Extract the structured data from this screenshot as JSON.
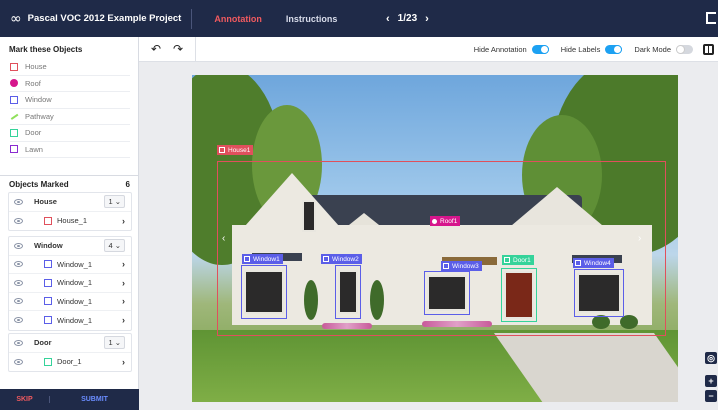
{
  "header": {
    "project_title": "Pascal VOC 2012 Example Project",
    "tabs": [
      {
        "label": "Annotation"
      },
      {
        "label": "Instructions"
      }
    ],
    "pager": {
      "prev": "‹",
      "text": "1/23",
      "next": "›"
    }
  },
  "sidebar": {
    "heading": "Mark these Objects",
    "objects": [
      {
        "label": "House",
        "color": "#e0505c",
        "shape": "square"
      },
      {
        "label": "Roof",
        "color": "#d6168c",
        "shape": "dot"
      },
      {
        "label": "Window",
        "color": "#5b5ee8",
        "shape": "square"
      },
      {
        "label": "Pathway",
        "color": "#8fe05a",
        "shape": "line"
      },
      {
        "label": "Door",
        "color": "#35d39a",
        "shape": "square"
      },
      {
        "label": "Lawn",
        "color": "#8a2bd0",
        "shape": "square"
      }
    ],
    "marked": {
      "heading": "Objects Marked",
      "count": "6",
      "groups": [
        {
          "name": "House",
          "count": "1",
          "items": [
            {
              "label": "House_1",
              "color": "#e0505c"
            }
          ]
        },
        {
          "name": "Window",
          "count": "4",
          "items": [
            {
              "label": "Window_1",
              "color": "#5b5ee8"
            },
            {
              "label": "Window_1",
              "color": "#5b5ee8"
            },
            {
              "label": "Window_1",
              "color": "#5b5ee8"
            },
            {
              "label": "Window_1",
              "color": "#5b5ee8"
            }
          ]
        },
        {
          "name": "Door",
          "count": "1",
          "items": [
            {
              "label": "Door_1",
              "color": "#35d39a"
            }
          ]
        }
      ]
    },
    "footer": {
      "skip": "SKIP",
      "submit": "SUBMIT"
    }
  },
  "toolbar": {
    "undo_icon": "undo-icon",
    "redo_icon": "redo-icon",
    "toggles": [
      {
        "label": "Hide Annotation",
        "on": true
      },
      {
        "label": "Hide Labels",
        "on": true
      },
      {
        "label": "Dark Mode",
        "on": false
      }
    ]
  },
  "annotations": [
    {
      "label": "House1",
      "color": "#e0505c",
      "marker": "square"
    },
    {
      "label": "Roof1",
      "color": "#d6168c",
      "marker": "dot"
    },
    {
      "label": "Window1",
      "color": "#5b5ee8",
      "marker": "square"
    },
    {
      "label": "Window2",
      "color": "#5b5ee8",
      "marker": "square"
    },
    {
      "label": "Window3",
      "color": "#5b5ee8",
      "marker": "square"
    },
    {
      "label": "Door1",
      "color": "#35d39a",
      "marker": "square"
    },
    {
      "label": "Window4",
      "color": "#5b5ee8",
      "marker": "square"
    }
  ],
  "controls": {
    "zoom_in": "+",
    "zoom_out": "−"
  }
}
